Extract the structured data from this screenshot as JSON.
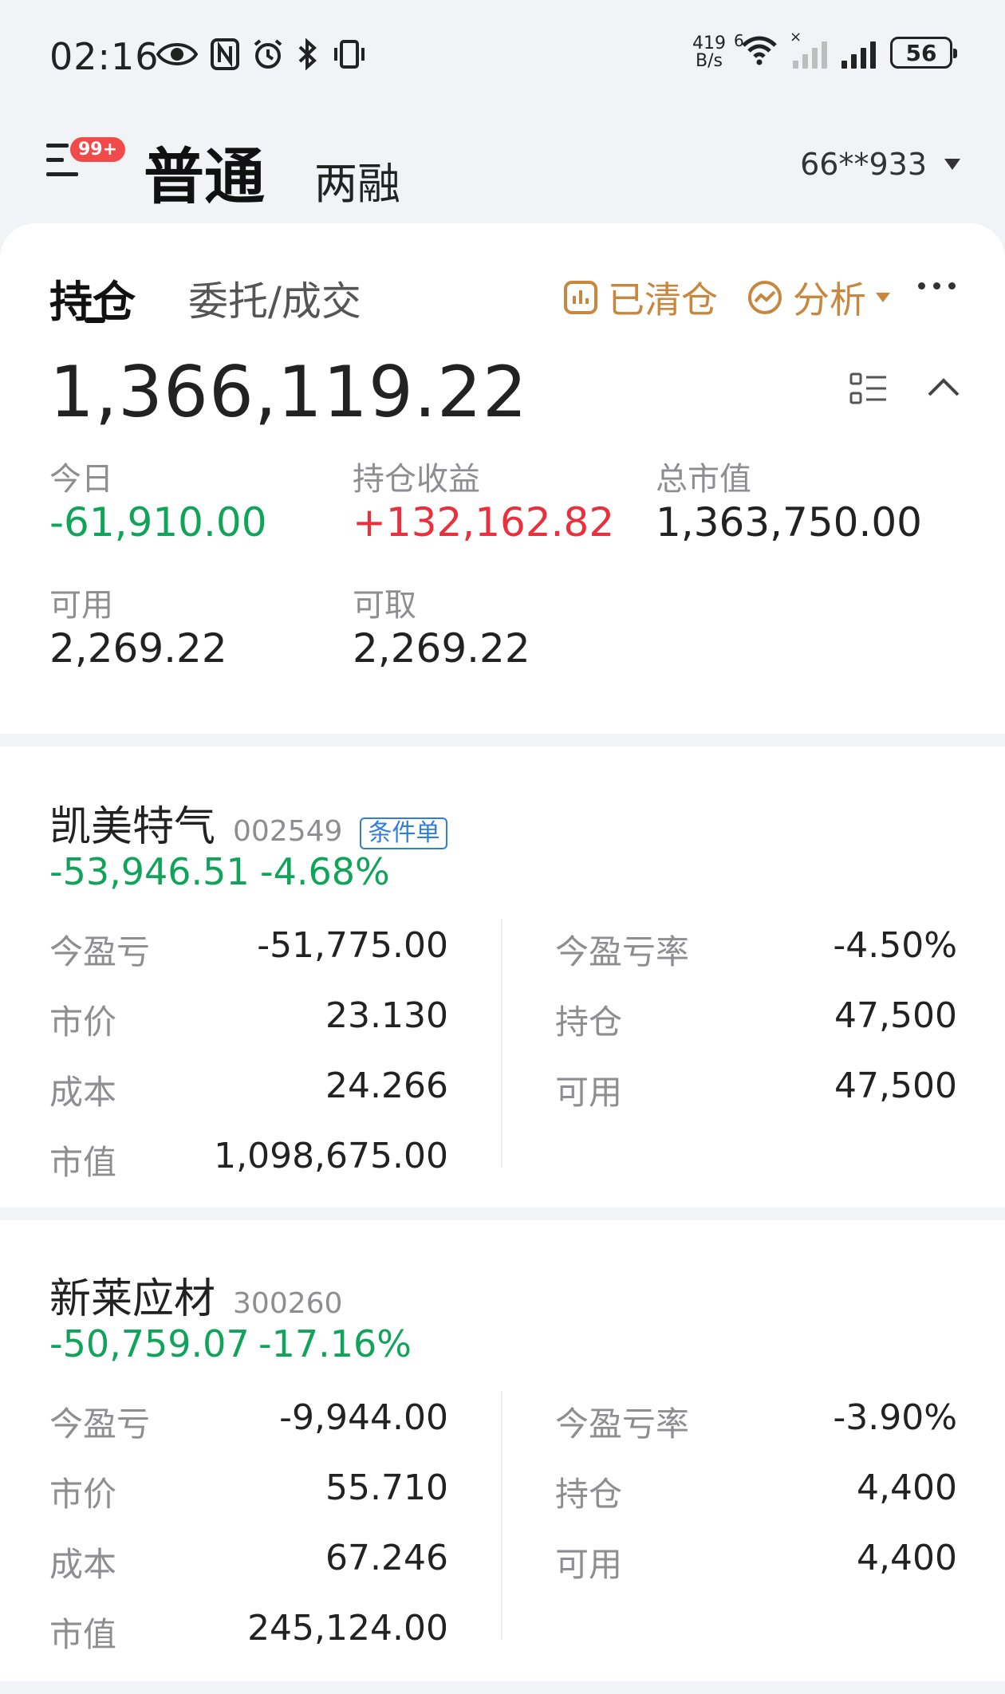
{
  "status_bar": {
    "time": "02:16",
    "net_speed_value": "419",
    "net_speed_unit": "B/s",
    "wifi_label": "6",
    "battery": "56",
    "icons": [
      "eye-icon",
      "nfc-icon",
      "alarm-icon",
      "bluetooth-icon",
      "vibrate-icon",
      "wifi-icon",
      "signal-icon",
      "battery-icon"
    ]
  },
  "header": {
    "badge": "99+",
    "tab_normal": "普通",
    "tab_margin": "两融",
    "account": "66**933"
  },
  "tabs": {
    "holdings": "持仓",
    "orders": "委托/成交"
  },
  "actions": {
    "cleared": "已清仓",
    "analysis": "分析"
  },
  "summary": {
    "total_asset": "1,366,119.22",
    "today_label": "今日",
    "today_value": "-61,910.00",
    "holding_profit_label": "持仓收益",
    "holding_profit_value": "+132,162.82",
    "market_value_label": "总市值",
    "market_value_value": "1,363,750.00",
    "available_label": "可用",
    "available_value": "2,269.22",
    "withdrawable_label": "可取",
    "withdrawable_value": "2,269.22"
  },
  "stocks": [
    {
      "name": "凯美特气",
      "code": "002549",
      "tag": "条件单",
      "profit": "-53,946.51",
      "profit_pct": "-4.68%",
      "today_pl_label": "今盈亏",
      "today_pl": "-51,775.00",
      "price_label": "市价",
      "price": "23.130",
      "cost_label": "成本",
      "cost": "24.266",
      "mv_label": "市值",
      "mv": "1,098,675.00",
      "today_rate_label": "今盈亏率",
      "today_rate": "-4.50%",
      "position_label": "持仓",
      "position": "47,500",
      "avail_label": "可用",
      "avail": "47,500"
    },
    {
      "name": "新莱应材",
      "code": "300260",
      "profit": "-50,759.07",
      "profit_pct": "-17.16%",
      "today_pl_label": "今盈亏",
      "today_pl": "-9,944.00",
      "price_label": "市价",
      "price": "55.710",
      "cost_label": "成本",
      "cost": "67.246",
      "mv_label": "市值",
      "mv": "245,124.00",
      "today_rate_label": "今盈亏率",
      "today_rate": "-3.90%",
      "position_label": "持仓",
      "position": "4,400",
      "avail_label": "可用",
      "avail": "4,400"
    }
  ],
  "colors": {
    "up": "#e8313d",
    "down": "#10a45a",
    "accent": "#c7873e",
    "tag": "#2f7ddc"
  }
}
